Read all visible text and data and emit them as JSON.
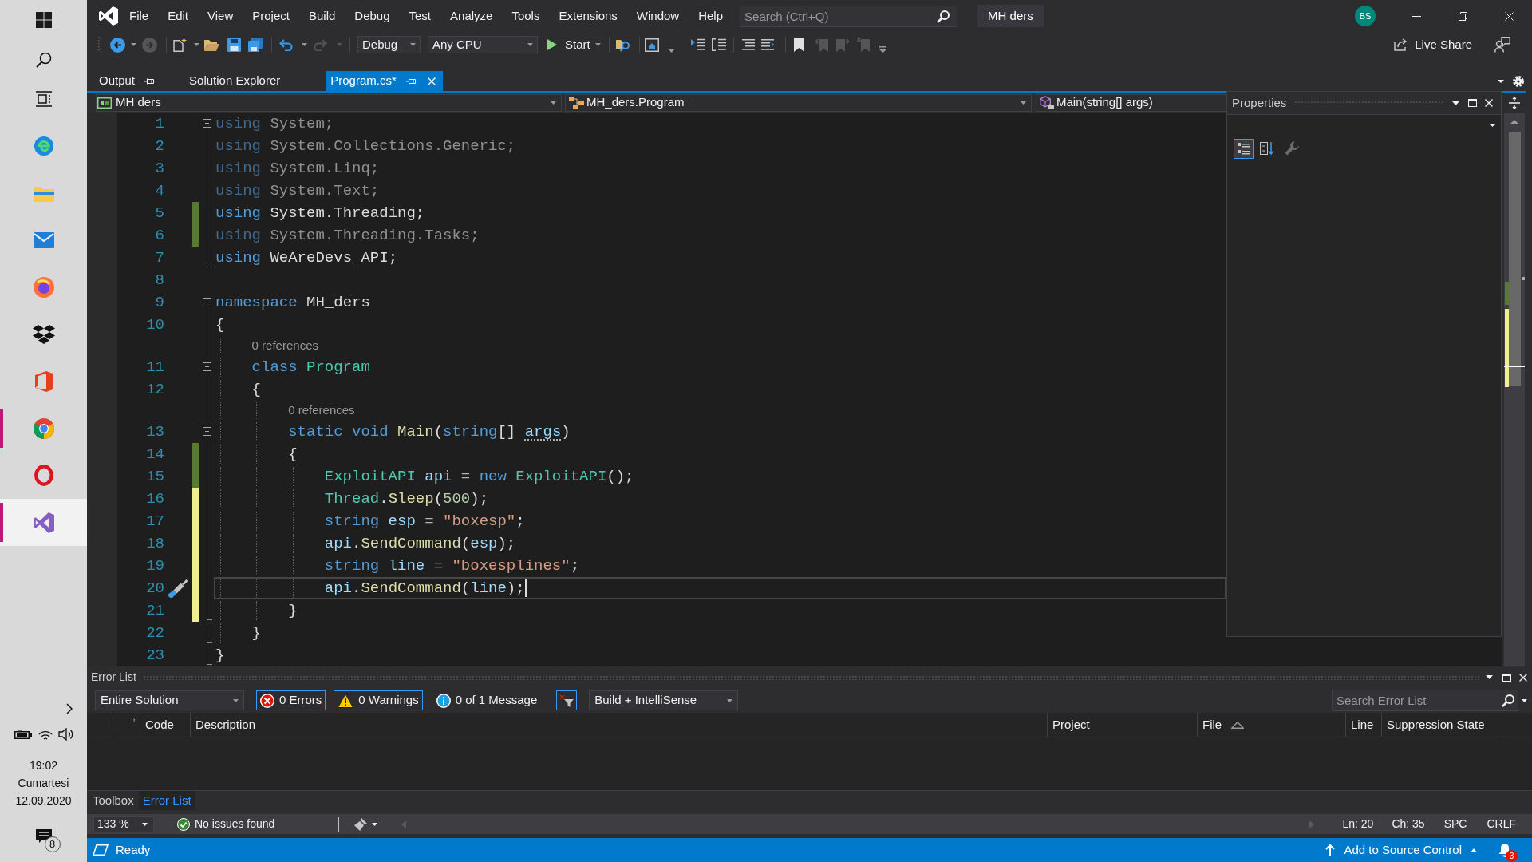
{
  "taskbar": {
    "apps": [
      {
        "running": false,
        "selected": false
      },
      {
        "running": false,
        "selected": false
      },
      {
        "running": false,
        "selected": false
      },
      {
        "running": false,
        "selected": false
      },
      {
        "running": false,
        "selected": false
      },
      {
        "running": false,
        "selected": false
      },
      {
        "running": true,
        "selected": false
      },
      {
        "running": false,
        "selected": false
      },
      {
        "running": true,
        "selected": true
      }
    ],
    "clock": {
      "time": "19:02",
      "day": "Cumartesi",
      "date": "12.09.2020"
    },
    "notification_count": "8"
  },
  "menu_bar": {
    "items": [
      "File",
      "Edit",
      "View",
      "Project",
      "Build",
      "Debug",
      "Test",
      "Analyze",
      "Tools",
      "Extensions",
      "Window",
      "Help"
    ],
    "search": {
      "placeholder": "Search (Ctrl+Q)"
    },
    "solution_name": "MH ders",
    "account_initials": "BS"
  },
  "toolbar": {
    "configuration": "Debug",
    "platform": "Any CPU",
    "start": "Start",
    "live_share": "Live Share"
  },
  "document_tabs": [
    {
      "label": "Output",
      "selected": false,
      "pin": true,
      "closable": false
    },
    {
      "label": "Solution Explorer",
      "selected": false,
      "pin": false,
      "closable": false
    },
    {
      "label": "Program.cs*",
      "selected": true,
      "pin": true,
      "closable": true
    }
  ],
  "navigation_bar": {
    "project": "MH ders",
    "type": "MH_ders.Program",
    "member": "Main(string[] args)"
  },
  "editor": {
    "lines": [
      {
        "number": "1",
        "expanded": true,
        "faded": true,
        "current": false,
        "tokens": [
          {
            "text": "using",
            "kind": "keyword"
          },
          {
            "text": " System;",
            "kind": "plain"
          }
        ]
      },
      {
        "number": "2",
        "faded": true,
        "current": false,
        "tokens": [
          {
            "text": "using",
            "kind": "keyword"
          },
          {
            "text": " System.Collections.Generic;",
            "kind": "plain"
          }
        ]
      },
      {
        "number": "3",
        "faded": true,
        "current": false,
        "tokens": [
          {
            "text": "using",
            "kind": "keyword"
          },
          {
            "text": " System.Linq;",
            "kind": "plain"
          }
        ]
      },
      {
        "number": "4",
        "faded": true,
        "current": false,
        "tokens": [
          {
            "text": "using",
            "kind": "keyword"
          },
          {
            "text": " System.Text;",
            "kind": "plain"
          }
        ]
      },
      {
        "number": "5",
        "color": "#587c2f",
        "faded": false,
        "current": false,
        "tokens": [
          {
            "text": "using",
            "kind": "keyword"
          },
          {
            "text": " System.Threading;",
            "kind": "plain"
          }
        ]
      },
      {
        "number": "6",
        "color": "#587c2f",
        "faded": true,
        "current": false,
        "tokens": [
          {
            "text": "using",
            "kind": "keyword"
          },
          {
            "text": " System.Threading.Tasks;",
            "kind": "plain"
          }
        ]
      },
      {
        "number": "7",
        "fold_end": true,
        "faded": false,
        "current": false,
        "tokens": [
          {
            "text": "using",
            "kind": "keyword"
          },
          {
            "text": " WeAreDevs_API;",
            "kind": "plain"
          }
        ]
      },
      {
        "number": "8",
        "current": false
      },
      {
        "number": "9",
        "expanded": true,
        "faded": false,
        "current": false,
        "tokens": [
          {
            "text": "namespace",
            "kind": "keyword"
          },
          {
            "text": " MH_ders",
            "kind": "plain"
          }
        ]
      },
      {
        "number": "10",
        "faded": false,
        "current": false,
        "tokens": [
          {
            "text": "{",
            "kind": "plain"
          }
        ]
      },
      {
        "number": "11",
        "codelens": "0 references",
        "expanded": true,
        "faded": false,
        "current": false,
        "tokens": [
          {
            "text": "    class ",
            "kind": "keyword"
          },
          {
            "text": "Program",
            "kind": "type"
          }
        ]
      },
      {
        "number": "12",
        "faded": false,
        "current": false,
        "tokens": [
          {
            "text": "    {",
            "kind": "plain"
          }
        ]
      },
      {
        "number": "13",
        "codelens": "0 references",
        "expanded": true,
        "faded": false,
        "current": false,
        "tokens": [
          {
            "text": "        static void ",
            "kind": "keyword"
          },
          {
            "text": "Main",
            "kind": "method"
          },
          {
            "text": "(",
            "kind": "plain"
          },
          {
            "text": "string",
            "kind": "keyword"
          },
          {
            "text": "[] ",
            "kind": "plain"
          },
          {
            "text": "args",
            "kind": "variable",
            "hint": true
          },
          {
            "text": ")",
            "kind": "plain"
          }
        ]
      },
      {
        "number": "14",
        "color": "#587c2f",
        "faded": false,
        "current": false,
        "tokens": [
          {
            "text": "        {",
            "kind": "plain"
          }
        ]
      },
      {
        "number": "15",
        "color": "#587c2f",
        "faded": false,
        "current": false,
        "tokens": [
          {
            "text": "            ExploitAPI",
            "kind": "type"
          },
          {
            "text": " api",
            "kind": "variable"
          },
          {
            "text": " = ",
            "kind": "operator"
          },
          {
            "text": "new ",
            "kind": "keyword"
          },
          {
            "text": "ExploitAPI",
            "kind": "type"
          },
          {
            "text": "();",
            "kind": "plain"
          }
        ]
      },
      {
        "number": "16",
        "color": "#efef92",
        "faded": false,
        "current": false,
        "tokens": [
          {
            "text": "            Thread",
            "kind": "type"
          },
          {
            "text": ".",
            "kind": "plain"
          },
          {
            "text": "Sleep",
            "kind": "method"
          },
          {
            "text": "(",
            "kind": "plain"
          },
          {
            "text": "500",
            "kind": "number"
          },
          {
            "text": ");",
            "kind": "plain"
          }
        ]
      },
      {
        "number": "17",
        "color": "#efef92",
        "faded": false,
        "current": false,
        "tokens": [
          {
            "text": "            string",
            "kind": "keyword"
          },
          {
            "text": " esp",
            "kind": "variable"
          },
          {
            "text": " = ",
            "kind": "operator"
          },
          {
            "text": "\"boxesp\"",
            "kind": "string"
          },
          {
            "text": ";",
            "kind": "plain"
          }
        ]
      },
      {
        "number": "18",
        "color": "#efef92",
        "faded": false,
        "current": false,
        "tokens": [
          {
            "text": "            api",
            "kind": "variable"
          },
          {
            "text": ".",
            "kind": "plain"
          },
          {
            "text": "SendCommand",
            "kind": "method"
          },
          {
            "text": "(",
            "kind": "plain"
          },
          {
            "text": "esp",
            "kind": "variable"
          },
          {
            "text": ");",
            "kind": "plain"
          }
        ]
      },
      {
        "number": "19",
        "color": "#efef92",
        "faded": false,
        "current": false,
        "tokens": [
          {
            "text": "            string",
            "kind": "keyword"
          },
          {
            "text": " line",
            "kind": "variable"
          },
          {
            "text": " = ",
            "kind": "operator"
          },
          {
            "text": "\"boxesplines\"",
            "kind": "string"
          },
          {
            "text": ";",
            "kind": "plain"
          }
        ]
      },
      {
        "number": "20",
        "color": "#efef92",
        "faded": false,
        "current": true,
        "tokens": [
          {
            "text": "            api",
            "kind": "variable"
          },
          {
            "text": ".",
            "kind": "plain"
          },
          {
            "text": "SendCommand",
            "kind": "method"
          },
          {
            "text": "(",
            "kind": "plain"
          },
          {
            "text": "line",
            "kind": "variable"
          },
          {
            "text": ");",
            "kind": "plain"
          }
        ]
      },
      {
        "number": "21",
        "fold_end": true,
        "color": "#efef92",
        "faded": false,
        "current": false,
        "tokens": [
          {
            "text": "        }",
            "kind": "plain"
          }
        ]
      },
      {
        "number": "22",
        "fold_end": true,
        "faded": false,
        "current": false,
        "tokens": [
          {
            "text": "    }",
            "kind": "plain"
          }
        ]
      },
      {
        "number": "23",
        "fold_end": true,
        "faded": false,
        "current": false,
        "tokens": [
          {
            "text": "}",
            "kind": "plain"
          }
        ]
      }
    ]
  },
  "properties_panel": {
    "title": "Properties",
    "view_buttons": [
      {
        "selected": true
      },
      {
        "selected": false
      }
    ],
    "property_pages_button": {
      "disabled": true
    }
  },
  "error_list": {
    "title": "Error List",
    "scope": "Entire Solution",
    "filters": [
      {
        "kind": "error",
        "label": "0 Errors",
        "on": true
      },
      {
        "kind": "warning",
        "label": "0 Warnings",
        "on": true
      },
      {
        "kind": "message",
        "label": "0 of 1 Message",
        "on": false
      }
    ],
    "filter_button": {
      "on": true
    },
    "source": "Build + IntelliSense",
    "search": {
      "placeholder": "Search Error List"
    },
    "columns": [
      {
        "label": "Code"
      },
      {
        "label": "Description"
      },
      {
        "label": "Project"
      },
      {
        "label": "File",
        "sorted": true
      },
      {
        "label": "Line"
      },
      {
        "label": "Suppression State"
      }
    ]
  },
  "tool_tabs": [
    {
      "label": "Toolbox",
      "selected": false
    },
    {
      "label": "Error List",
      "selected": true
    }
  ],
  "editor_status": {
    "zoom": "133 %",
    "issues": "No issues found",
    "line": "Ln: 20",
    "column": "Ch: 35",
    "indentation": "SPC",
    "line_endings": "CRLF"
  },
  "status_bar": {
    "state": "Ready",
    "source_control": "Add to Source Control",
    "notification_count": "3"
  }
}
